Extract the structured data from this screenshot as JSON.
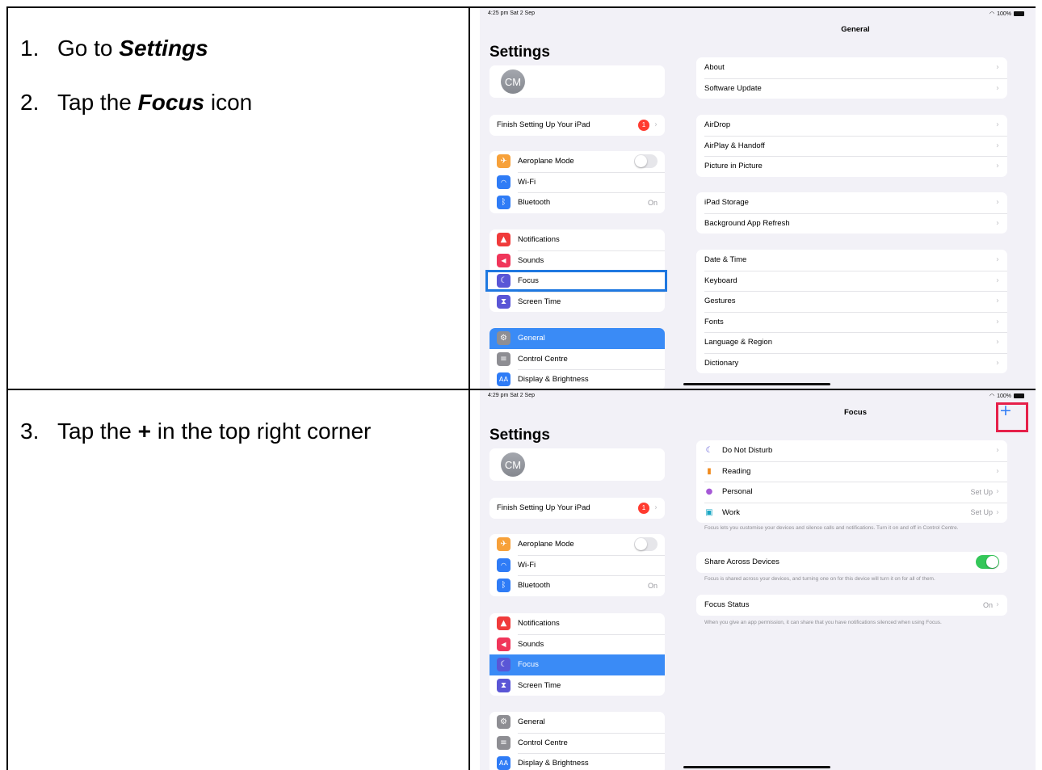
{
  "steps": {
    "s1": {
      "num": "1.",
      "pre": "Go to ",
      "em": "Settings",
      "post": ""
    },
    "s2": {
      "num": "2.",
      "pre": "Tap the ",
      "em": "Focus",
      "post": " icon"
    },
    "s3": {
      "num": "3.",
      "pre": "Tap the ",
      "plus": "+",
      "post": " in the top right corner"
    }
  },
  "screen1": {
    "time": "4:25 pm  Sat 2 Sep",
    "battery": "100%",
    "sidebar_title": "Settings",
    "avatar": "CM",
    "setup": {
      "label": "Finish Setting Up Your iPad",
      "badge": "1"
    },
    "conn": [
      {
        "label": "Aeroplane Mode",
        "icon": "airplane-icon",
        "color": "#f7a13a"
      },
      {
        "label": "Wi-Fi",
        "icon": "wifi-icon",
        "color": "#2f7cf6"
      },
      {
        "label": "Bluetooth",
        "icon": "bluetooth-icon",
        "color": "#2f7cf6",
        "value": "On"
      }
    ],
    "notif": [
      {
        "label": "Notifications",
        "icon": "bell-icon",
        "color": "#f03b3b"
      },
      {
        "label": "Sounds",
        "icon": "speaker-icon",
        "color": "#f0365a"
      },
      {
        "label": "Focus",
        "icon": "moon-icon",
        "color": "#5a56d6"
      },
      {
        "label": "Screen Time",
        "icon": "hourglass-icon",
        "color": "#5a56d6"
      }
    ],
    "gen": [
      {
        "label": "General",
        "icon": "gear-icon",
        "color": "#8e8e93"
      },
      {
        "label": "Control Centre",
        "icon": "switches-icon",
        "color": "#8e8e93"
      },
      {
        "label": "Display & Brightness",
        "icon": "display-icon",
        "color": "#2f7cf6"
      }
    ],
    "detail_title": "General",
    "groups": [
      [
        "About",
        "Software Update"
      ],
      [
        "AirDrop",
        "AirPlay & Handoff",
        "Picture in Picture"
      ],
      [
        "iPad Storage",
        "Background App Refresh"
      ],
      [
        "Date & Time",
        "Keyboard",
        "Gestures",
        "Fonts",
        "Language & Region",
        "Dictionary"
      ]
    ]
  },
  "screen2": {
    "time": "4:29 pm  Sat 2 Sep",
    "battery": "100%",
    "sidebar_title": "Settings",
    "avatar": "CM",
    "detail_title": "Focus",
    "plus": "+",
    "modes": [
      {
        "label": "Do Not Disturb",
        "icon": "moon-icon",
        "color": "#5a56d6"
      },
      {
        "label": "Reading",
        "icon": "book-icon",
        "color": "#f08a1c"
      },
      {
        "label": "Personal",
        "icon": "person-icon",
        "color": "#a558d6",
        "value": "Set Up"
      },
      {
        "label": "Work",
        "icon": "badge-icon",
        "color": "#1aa7c4",
        "value": "Set Up"
      }
    ],
    "note1": "Focus lets you customise your devices and silence calls and notifications. Turn it on and off in Control Centre.",
    "share_label": "Share Across Devices",
    "note2": "Focus is shared across your devices, and turning one on for this device will turn it on for all of them.",
    "status_label": "Focus Status",
    "status_value": "On",
    "note3": "When you give an app permission, it can share that you have notifications silenced when using Focus."
  }
}
